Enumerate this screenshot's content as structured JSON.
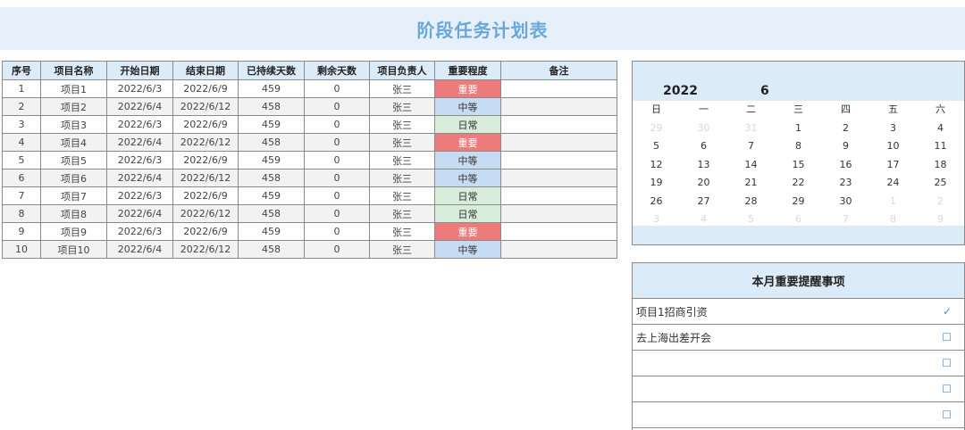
{
  "title": "阶段任务计划表",
  "table": {
    "headers": [
      "序号",
      "项目名称",
      "开始日期",
      "结束日期",
      "已持续天数",
      "剩余天数",
      "项目负责人",
      "重要程度",
      "备注"
    ],
    "rows": [
      [
        "1",
        "项目1",
        "2022/6/3",
        "2022/6/9",
        "459",
        "0",
        "张三",
        "重要",
        ""
      ],
      [
        "2",
        "项目2",
        "2022/6/4",
        "2022/6/12",
        "458",
        "0",
        "张三",
        "中等",
        ""
      ],
      [
        "3",
        "项目3",
        "2022/6/3",
        "2022/6/9",
        "459",
        "0",
        "张三",
        "日常",
        ""
      ],
      [
        "4",
        "项目4",
        "2022/6/4",
        "2022/6/12",
        "458",
        "0",
        "张三",
        "重要",
        ""
      ],
      [
        "5",
        "项目5",
        "2022/6/3",
        "2022/6/9",
        "459",
        "0",
        "张三",
        "中等",
        ""
      ],
      [
        "6",
        "项目6",
        "2022/6/4",
        "2022/6/12",
        "458",
        "0",
        "张三",
        "中等",
        ""
      ],
      [
        "7",
        "项目7",
        "2022/6/3",
        "2022/6/9",
        "459",
        "0",
        "张三",
        "日常",
        ""
      ],
      [
        "8",
        "项目8",
        "2022/6/4",
        "2022/6/12",
        "458",
        "0",
        "张三",
        "日常",
        ""
      ],
      [
        "9",
        "项目9",
        "2022/6/3",
        "2022/6/9",
        "459",
        "0",
        "张三",
        "重要",
        ""
      ],
      [
        "10",
        "项目10",
        "2022/6/4",
        "2022/6/12",
        "458",
        "0",
        "张三",
        "中等",
        ""
      ]
    ],
    "level_colors": {
      "重要": "#ee7b7b",
      "中等": "#c6dcf2",
      "日常": "#d7ecd9"
    }
  },
  "calendar": {
    "year": "2022",
    "month": "6",
    "weekdays": [
      "日",
      "一",
      "二",
      "三",
      "四",
      "五",
      "六"
    ],
    "weeks": [
      [
        "29",
        "30",
        "31",
        "1",
        "2",
        "3",
        "4"
      ],
      [
        "5",
        "6",
        "7",
        "8",
        "9",
        "10",
        "11"
      ],
      [
        "12",
        "13",
        "14",
        "15",
        "16",
        "17",
        "18"
      ],
      [
        "19",
        "20",
        "21",
        "22",
        "23",
        "24",
        "25"
      ],
      [
        "26",
        "27",
        "28",
        "29",
        "30",
        "1",
        "2"
      ],
      [
        "3",
        "4",
        "5",
        "6",
        "7",
        "8",
        "9"
      ]
    ],
    "muted": [
      [
        0,
        0
      ],
      [
        0,
        1
      ],
      [
        0,
        2
      ],
      [
        4,
        5
      ],
      [
        4,
        6
      ],
      [
        5,
        0
      ],
      [
        5,
        1
      ],
      [
        5,
        2
      ],
      [
        5,
        3
      ],
      [
        5,
        4
      ],
      [
        5,
        5
      ],
      [
        5,
        6
      ]
    ]
  },
  "reminders": {
    "title": "本月重要提醒事项",
    "items": [
      {
        "text": "项目1招商引资",
        "mark": "✓"
      },
      {
        "text": "去上海出差开会",
        "mark": "☐"
      },
      {
        "text": "",
        "mark": "☐"
      },
      {
        "text": "",
        "mark": "☐"
      },
      {
        "text": "",
        "mark": "☐"
      }
    ]
  }
}
